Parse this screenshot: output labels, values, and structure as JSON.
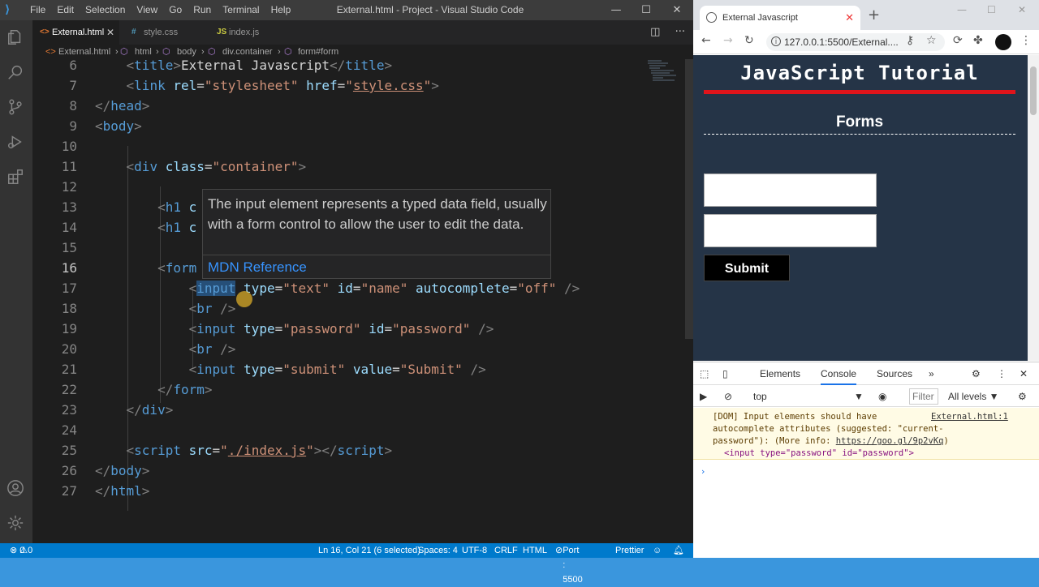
{
  "vscode": {
    "menu": [
      "File",
      "Edit",
      "Selection",
      "View",
      "Go",
      "Run",
      "Terminal",
      "Help"
    ],
    "window_title": "External.html - Project - Visual Studio Code",
    "tabs": [
      {
        "label": "External.html",
        "icon": "<>",
        "icon_color": "#e37933",
        "active": true
      },
      {
        "label": "style.css",
        "icon": "#",
        "icon_color": "#519aba",
        "active": false
      },
      {
        "label": "index.js",
        "icon": "JS",
        "icon_color": "#cbcb41",
        "active": false
      }
    ],
    "breadcrumb": [
      "External.html",
      "html",
      "body",
      "div.container",
      "form#form"
    ],
    "hover": {
      "description": "The input element represents a typed data field, usually with a form control to allow the user to edit the data.",
      "link": "MDN Reference"
    },
    "status": {
      "errors": "0",
      "warnings": "0",
      "position": "Ln 16, Col 21 (6 selected)",
      "spaces": "Spaces: 4",
      "encoding": "UTF-8",
      "eol": "CRLF",
      "language": "HTML",
      "port": "Port : 5500",
      "formatter": "Prettier"
    }
  },
  "chrome": {
    "tab_title": "External Javascript",
    "url": "127.0.0.1:5500/External....",
    "page": {
      "heading": "JavaScript Tutorial",
      "subheading": "Forms",
      "submit_label": "Submit"
    },
    "devtools": {
      "tabs": [
        "Elements",
        "Console",
        "Sources"
      ],
      "context": "top",
      "filter_placeholder": "Filter",
      "levels": "All levels ▼",
      "issue_line1": "[DOM] Input elements should have",
      "issue_source": "External.html:1",
      "issue_line2": "autocomplete attributes (suggested: \"current-",
      "issue_line3a": "password\"): (More info: ",
      "issue_link": "https://goo.gl/9p2vKq",
      "issue_line3b": ")",
      "issue_element": "<input type=\"password\" id=\"password\">",
      "prompt": "›"
    }
  }
}
